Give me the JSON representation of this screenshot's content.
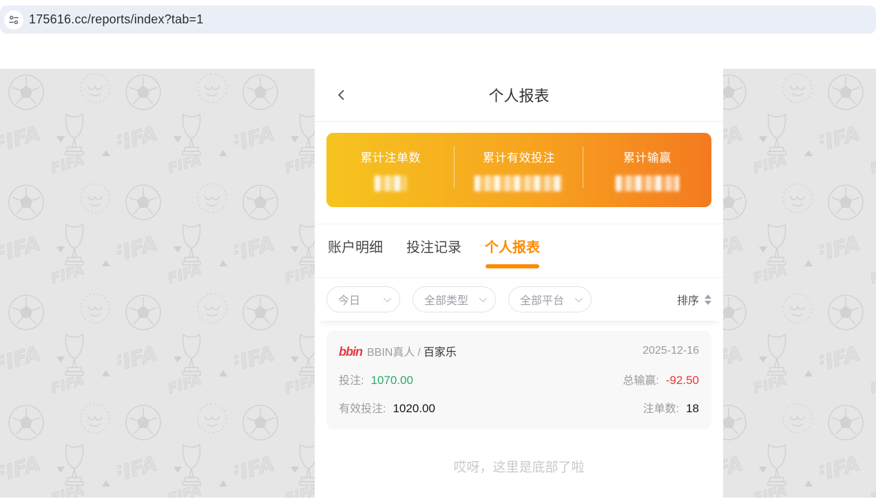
{
  "browser": {
    "url": "175616.cc/reports/index?tab=1",
    "bar_icon": "tune-sliders-icon"
  },
  "page": {
    "header": {
      "title": "个人报表"
    },
    "summary": {
      "items": [
        {
          "label": "累计注单数",
          "value_masked": true
        },
        {
          "label": "累计有效投注",
          "value_masked": true
        },
        {
          "label": "累计输赢",
          "value_masked": true
        }
      ]
    },
    "tabs": [
      {
        "label": "账户明细",
        "active": false
      },
      {
        "label": "投注记录",
        "active": false
      },
      {
        "label": "个人报表",
        "active": true
      }
    ],
    "filters": {
      "dropdowns": [
        "今日",
        "全部类型",
        "全部平台"
      ],
      "sort_label": "排序"
    },
    "report_card": {
      "logo_text": "bbin",
      "provider": "BBIN真人",
      "separator": "/",
      "game": "百家乐",
      "date": "2025-12-16",
      "bet_label": "投注:",
      "bet_value": "1070.00",
      "net_label": "总输赢:",
      "net_value": "-92.50",
      "valid_label": "有效投注:",
      "valid_value": "1020.00",
      "count_label": "注单数:",
      "count_value": "18"
    },
    "footer": "哎呀，这里是底部了啦"
  },
  "colors": {
    "accent_orange": "#ff8a00",
    "gradient_from": "#f6c41f",
    "gradient_to": "#f47a20",
    "positive_green": "#2fa86b",
    "negative_red": "#e8382d",
    "urlbar_bg": "#eaeef6",
    "pattern_bg": "#e6e6e7",
    "logo_red": "#e23b3f"
  }
}
